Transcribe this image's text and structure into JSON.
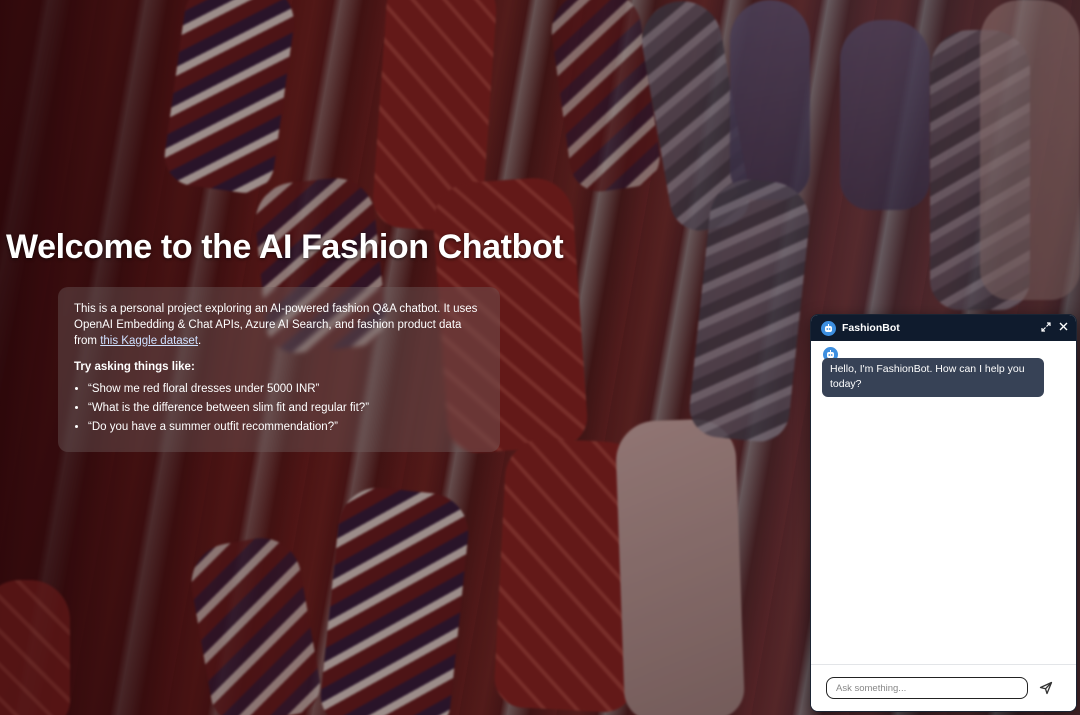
{
  "page": {
    "title": "Welcome to the AI Fashion Chatbot"
  },
  "intro": {
    "description": "This is a personal project exploring an AI-powered fashion Q&A chatbot. It uses OpenAI Embedding & Chat APIs, Azure AI Search, and fashion product data from",
    "link_text": "this Kaggle dataset",
    "link_suffix": ".",
    "try_heading": "Try asking things like:",
    "examples": [
      "“Show me red floral dresses under 5000 INR”",
      "“What is the difference between slim fit and regular fit?”",
      "“Do you have a summer outfit recommendation?”"
    ]
  },
  "chat": {
    "bot_name": "FashionBot",
    "messages": [
      {
        "from": "bot",
        "text": "Hello, I'm FashionBot. How can I help you today?"
      }
    ],
    "input_placeholder": "Ask something...",
    "input_value": ""
  },
  "colors": {
    "header_bg": "#0f1b2d",
    "bubble_bg": "#374256",
    "avatar_accent": "#3d8fe0",
    "link": "#cfe0ff"
  },
  "icons": {
    "background": "neckties-photo",
    "avatar": "bot-avatar-icon",
    "expand": "expand-icon",
    "close": "close-icon",
    "send": "send-icon"
  }
}
